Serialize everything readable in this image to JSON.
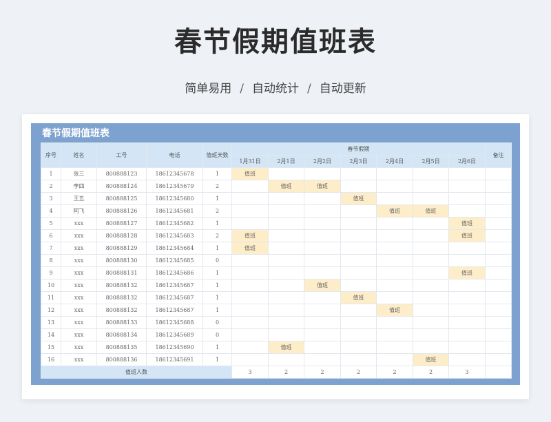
{
  "page": {
    "title": "春节假期值班表",
    "subtitle": [
      "简单易用",
      "自动统计",
      "自动更新"
    ],
    "subtitle_sep": "/"
  },
  "sheet": {
    "title": "春节假期值班表",
    "headers": {
      "index": "序号",
      "name": "姓名",
      "employee_id": "工号",
      "phone": "电话",
      "duty_days": "值班天数",
      "holiday_group": "春节假期",
      "remark": "备注"
    },
    "dates": [
      "1月31日",
      "2月1日",
      "2月2日",
      "2月3日",
      "2月4日",
      "2月5日",
      "2月6日"
    ],
    "duty_mark": "值班",
    "rows": [
      {
        "no": "1",
        "name": "张三",
        "id": "800888123",
        "phone": "18612345678",
        "days": "1",
        "duty": [
          0
        ]
      },
      {
        "no": "2",
        "name": "李四",
        "id": "800888124",
        "phone": "18612345679",
        "days": "2",
        "duty": [
          1,
          2
        ]
      },
      {
        "no": "3",
        "name": "王五",
        "id": "800888125",
        "phone": "18612345680",
        "days": "1",
        "duty": [
          3
        ]
      },
      {
        "no": "4",
        "name": "阿飞",
        "id": "800888126",
        "phone": "18612345681",
        "days": "2",
        "duty": [
          4,
          5
        ]
      },
      {
        "no": "5",
        "name": "xxx",
        "id": "800888127",
        "phone": "18612345682",
        "days": "1",
        "duty": [
          6
        ]
      },
      {
        "no": "6",
        "name": "xxx",
        "id": "800888128",
        "phone": "18612345683",
        "days": "2",
        "duty": [
          0,
          6
        ]
      },
      {
        "no": "7",
        "name": "xxx",
        "id": "800888129",
        "phone": "18612345684",
        "days": "1",
        "duty": [
          0
        ]
      },
      {
        "no": "8",
        "name": "xxx",
        "id": "800888130",
        "phone": "18612345685",
        "days": "0",
        "duty": []
      },
      {
        "no": "9",
        "name": "xxx",
        "id": "800888131",
        "phone": "18612345686",
        "days": "1",
        "duty": [
          6
        ]
      },
      {
        "no": "10",
        "name": "xxx",
        "id": "800888132",
        "phone": "18612345687",
        "days": "1",
        "duty": [
          2
        ]
      },
      {
        "no": "11",
        "name": "xxx",
        "id": "800888132",
        "phone": "18612345687",
        "days": "1",
        "duty": [
          3
        ]
      },
      {
        "no": "12",
        "name": "xxx",
        "id": "800888132",
        "phone": "18612345687",
        "days": "1",
        "duty": [
          4
        ]
      },
      {
        "no": "13",
        "name": "xxx",
        "id": "800888133",
        "phone": "18612345688",
        "days": "0",
        "duty": []
      },
      {
        "no": "14",
        "name": "xxx",
        "id": "800888134",
        "phone": "18612345689",
        "days": "0",
        "duty": []
      },
      {
        "no": "15",
        "name": "xxx",
        "id": "800888135",
        "phone": "18612345690",
        "days": "1",
        "duty": [
          1
        ]
      },
      {
        "no": "16",
        "name": "xxx",
        "id": "800888136",
        "phone": "18612345691",
        "days": "1",
        "duty": [
          5
        ]
      }
    ],
    "totals": {
      "label": "值班人数",
      "values": [
        "3",
        "2",
        "2",
        "2",
        "2",
        "2",
        "3"
      ]
    }
  },
  "colors": {
    "frame": "#7ea2cf",
    "header_bg": "#d4e6f5",
    "duty_bg": "#fdedc9"
  }
}
